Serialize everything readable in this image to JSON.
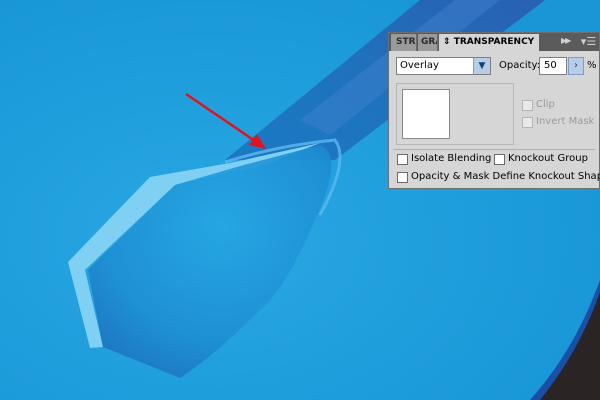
{
  "panel": {
    "tabs": [
      {
        "label": "STROKE",
        "active": false
      },
      {
        "label": "GRADIENT",
        "active": false
      },
      {
        "label": "TRANSPARENCY",
        "active": true
      }
    ],
    "blend_mode": "Overlay",
    "opacity_label": "Opacity:",
    "opacity_value": "50",
    "opacity_unit": "%",
    "clip_label": "Clip",
    "invert_mask_label": "Invert Mask",
    "isolate_blending_label": "Isolate Blending",
    "knockout_group_label": "Knockout Group",
    "opacity_mask_label": "Opacity & Mask Define Knockout Shape"
  },
  "colors": {
    "background": "#1e9fdd",
    "panel_bg": "#d6d6d6",
    "panel_tabbar": "#5b5b5b",
    "arrow_annotation": "#e5121b"
  },
  "icons": [
    "panel-collapse-icon",
    "panel-menu-icon",
    "dropdown-arrow-icon",
    "stepper-arrow-icon",
    "annotation-arrow-icon"
  ]
}
